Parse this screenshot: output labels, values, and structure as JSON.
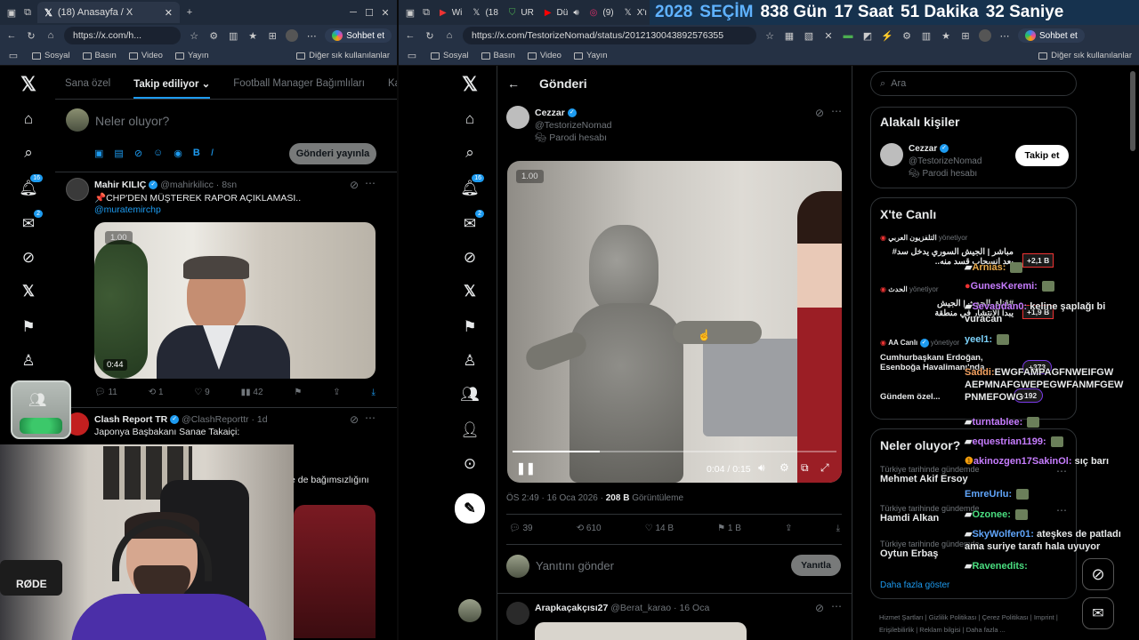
{
  "left_window": {
    "tab_title": "(18) Anasayfa / X",
    "url": "https://x.com/h...",
    "copilot": "Sohbet et",
    "bookmarks": [
      "Sosyal",
      "Basın",
      "Video",
      "Yayın"
    ],
    "other_bookmarks": "Diğer sık kullanılanlar",
    "feed_tabs": [
      "Sana özel",
      "Takip ediliyor",
      "Football Manager Bağımlıları",
      "Kardeşle"
    ],
    "compose_placeholder": "Neler oluyor?",
    "post_button": "Gönderi yayınla",
    "nav_badges": {
      "notifications": "16",
      "messages": "2"
    },
    "post1": {
      "name": "Mahir KILIÇ",
      "handle": "@mahirkilicc",
      "time": "· 8sn",
      "text": "📌CHP'DEN MÜŞTEREK RAPOR AÇIKLAMASI..",
      "mention": "@muratemirchp",
      "video_rate": "1.00",
      "video_time": "0:44",
      "stats": {
        "replies": "11",
        "reposts": "1",
        "likes": "9",
        "views": "42"
      }
    },
    "post2": {
      "name": "Clash Report TR",
      "handle": "@ClashReporttr",
      "time": "· 1d",
      "text": "Japonya Başbakanı Sanae Takaiçi:",
      "text2": "e de bağımsızlığını"
    },
    "webcam_logo": "RØDE"
  },
  "right_window": {
    "tabs": [
      "Wi",
      "(18",
      "UR",
      "Dü",
      "(9)",
      "X'ı"
    ],
    "url": "https://x.com/TestorizeNomad/status/2012130043892576355",
    "copilot": "Sohbet et",
    "bookmarks": [
      "Sosyal",
      "Basın",
      "Video",
      "Yayın"
    ],
    "other_bookmarks": "Diğer sık kullanılanlar",
    "countdown": {
      "year": "2028",
      "label": "SEÇİM",
      "days": "838 Gün",
      "hours": "17 Saat",
      "minutes": "51 Dakika",
      "seconds": "32 Saniye"
    },
    "header_title": "Gönderi",
    "nav_badges": {
      "notifications": "16",
      "messages": "2"
    },
    "author": {
      "name": "Cezzar",
      "handle": "@TestorizeNomad",
      "parody": "Parodi hesabı"
    },
    "video": {
      "rate": "1.00",
      "time": "0:04 / 0:15",
      "progress": 0.27
    },
    "meta": {
      "time": "ÖS 2:49 · 16 Oca 2026 ·",
      "views": "208 B",
      "views_label": "Görüntüleme"
    },
    "actions": {
      "replies": "39",
      "reposts": "610",
      "likes": "14 B",
      "bookmarks": "1 B"
    },
    "reply_placeholder": "Yanıtını gönder",
    "reply_button": "Yanıtla",
    "next_post": {
      "name": "Arapkaçakçısı27",
      "handle": "@Berat_karao",
      "time": "· 16 Oca"
    }
  },
  "sidebar": {
    "search_placeholder": "Ara",
    "related_title": "Alakalı kişiler",
    "related": {
      "name": "Cezzar",
      "handle": "@TestorizeNomad",
      "parody": "Parodi hesabı",
      "follow": "Takip et"
    },
    "live_title": "X'te Canlı",
    "live": [
      {
        "host": "التلفزيون العربي",
        "status": "yönetiyor",
        "title": "مباشر | الجيش السوري يدخل سد#",
        "title2": "بعد انسحاب قسد منه..",
        "count": "+2,1 B"
      },
      {
        "host": "الحدث",
        "status": "yönetiyor",
        "title": "#قناة_الحدث | الجيش",
        "title2": "يبدأ الانتشار في منطقة",
        "count": "+1,9 B"
      },
      {
        "host": "AA Canlı",
        "status": "yönetiyor",
        "title": "Cumhurbaşkanı Erdoğan,",
        "title2": "Esenboğa Havalimanı'nda",
        "count": "+373"
      },
      {
        "host": "Gündem özel...",
        "status": "",
        "title": "",
        "title2": "",
        "count": "+192"
      }
    ],
    "trends_title": "Neler oluyor?",
    "trends": [
      {
        "context": "Türkiye tarihinde gündemde",
        "name": "Mehmet Akif Ersoy"
      },
      {
        "context": "Türkiye tarihinde gündemde",
        "name": "Hamdi Alkan"
      },
      {
        "context": "Türkiye tarihinde gündemde",
        "name": "Oytun Erbaş"
      }
    ],
    "show_more": "Daha fazla göster",
    "footer": [
      "Hizmet Şartları",
      "Gizlilik Politikası",
      "Çerez Politikası",
      "Imprint",
      "Erişilebilirlik",
      "Reklam bilgisi",
      "Daha fazla ..."
    ]
  },
  "chat": [
    {
      "user": "Arnias:",
      "color": "#e8a94a",
      "text": ""
    },
    {
      "user": "GunesKeremi:",
      "color": "#c77dff",
      "text": ""
    },
    {
      "user": "Sevaudan0:",
      "color": "#c77dff",
      "text": "keline şaplağı bi vuracan"
    },
    {
      "user": "yeel1:",
      "color": "#7dd3fc",
      "text": ""
    },
    {
      "user": "Saddi:",
      "color": "#f4a261",
      "text": "EWGFAMPAGFNWEIFGW AEPMNAFGWEPEGWFANMFGEW PNMEFOWG"
    },
    {
      "user": "turntablee:",
      "color": "#c77dff",
      "text": ""
    },
    {
      "user": "equestrian1199:",
      "color": "#c77dff",
      "text": ""
    },
    {
      "user": "akinozgen17SakinOl:",
      "color": "#c77dff",
      "text": "sıç barı"
    },
    {
      "user": "EmreUrlu:",
      "color": "#60a5fa",
      "text": ""
    },
    {
      "user": "Ozonee:",
      "color": "#4ade80",
      "text": ""
    },
    {
      "user": "SkyWolfer01:",
      "color": "#60a5fa",
      "text": "ateşkes de patladı ama suriye tarafı hala uyuyor"
    },
    {
      "user": "Ravenedits:",
      "color": "#4ade80",
      "text": ""
    }
  ]
}
